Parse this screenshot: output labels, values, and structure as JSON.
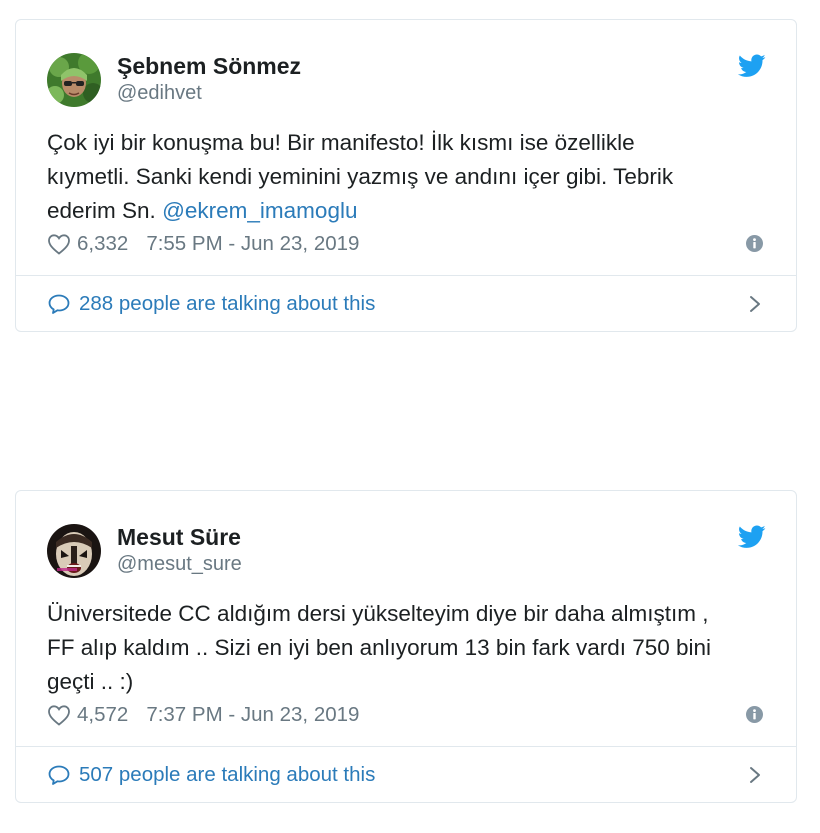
{
  "tweets": [
    {
      "author_name": "Şebnem Sönmez",
      "handle": "@edihvet",
      "text_lines": [
        "Çok iyi bir konuşma bu! Bir manifesto! İlk kısmı ise özellikle",
        "kıymetli. Sanki kendi yeminini yazmış ve andını içer gibi. Tebrik",
        "ederim Sn. "
      ],
      "mention": "@ekrem_imamoglu",
      "likes": "6,332",
      "timestamp": "7:55 PM - Jun 23, 2019",
      "talking": "288 people are talking about this",
      "icons": {
        "brand": "twitter-bird-icon",
        "like": "heart-icon",
        "info": "info-icon",
        "reply": "speech-bubble-icon",
        "more": "chevron-right-icon"
      }
    },
    {
      "author_name": "Mesut Süre",
      "handle": "@mesut_sure",
      "text_lines": [
        "Üniversitede CC aldığım dersi yükselteyim diye bir daha almıştım ,",
        "FF alıp kaldım ..  Sizi en iyi ben anlıyorum 13 bin fark vardı 750 bini",
        "geçti ..  :)"
      ],
      "mention": "",
      "likes": "4,572",
      "timestamp": "7:37 PM - Jun 23, 2019",
      "talking": "507 people are talking about this",
      "icons": {
        "brand": "twitter-bird-icon",
        "like": "heart-icon",
        "info": "info-icon",
        "reply": "speech-bubble-icon",
        "more": "chevron-right-icon"
      }
    }
  ],
  "colors": {
    "twitter_blue": "#1da1f2",
    "link_blue": "#2b7bb9",
    "muted_text": "#697882",
    "border": "#e1e8ed"
  }
}
